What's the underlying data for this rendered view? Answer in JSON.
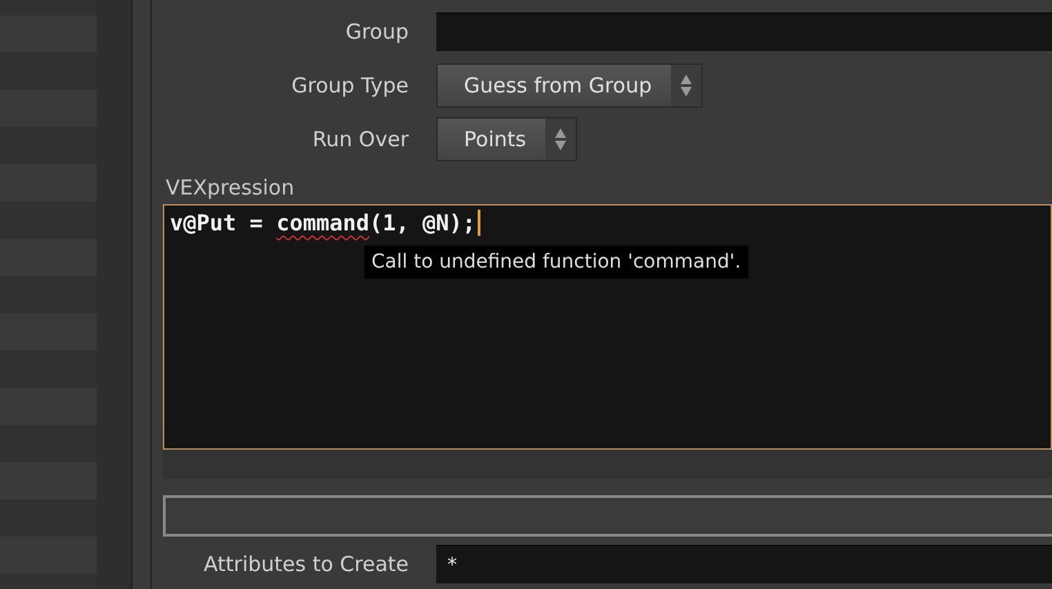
{
  "parameters": [
    {
      "kind": "field",
      "label": "Group"
    },
    {
      "kind": "menu",
      "label": "Group Type",
      "value": "Guess from Group"
    },
    {
      "kind": "menu",
      "label": "Run Over",
      "value": "Points"
    }
  ],
  "vexpression": {
    "label": "VEXpression",
    "focused": true,
    "code": [
      {
        "text": "v@Put = ",
        "error": false
      },
      {
        "text": "command",
        "error": true
      },
      {
        "text": "(1, @N);",
        "error": false
      }
    ],
    "tooltip": "Call to undefined function 'command'."
  },
  "bottom_parameters": [
    {
      "kind": "field",
      "label": "Attributes to Create",
      "value": "*"
    }
  ]
}
